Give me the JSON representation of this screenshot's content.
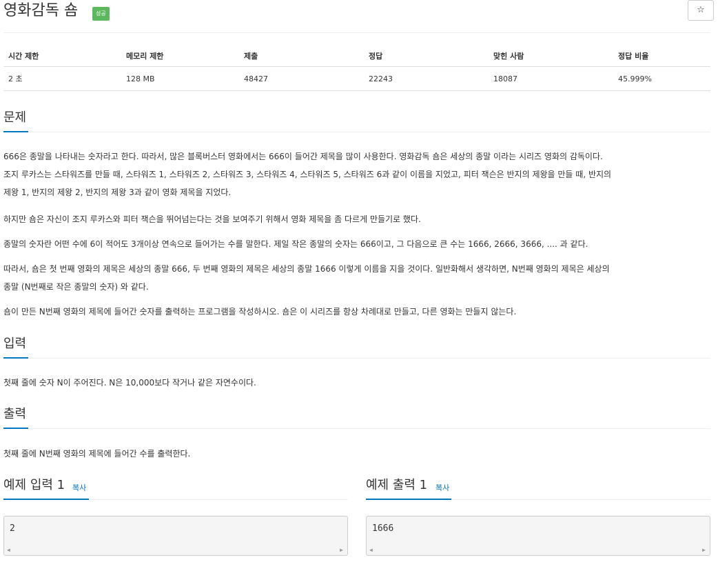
{
  "header": {
    "title": "영화감독 숌",
    "badge": "성공",
    "star": "☆"
  },
  "info_table": {
    "columns": [
      "시간 제한",
      "메모리 제한",
      "제출",
      "정답",
      "맞힌 사람",
      "정답 비율"
    ],
    "values": [
      "2 초",
      "128 MB",
      "48427",
      "22243",
      "18087",
      "45.999%"
    ]
  },
  "problem": {
    "heading": "문제",
    "p1_l1": "666은 종말을 나타내는 숫자라고 한다. 따라서, 많은 블록버스터 영화에서는 666이 들어간 제목을 많이 사용한다. 영화감독 숌은 세상의 종말 이라는 시리즈 영화의 감독이다.",
    "p1_l2": "조지 루카스는 스타워즈를 만들 때, 스타워즈 1, 스타워즈 2, 스타워즈 3, 스타워즈 4, 스타워즈 5, 스타워즈 6과 같이 이름을 지었고, 피터 잭슨은 반지의 제왕을 만들 때, 반지의",
    "p1_l3": "제왕 1, 반지의 제왕 2, 반지의 제왕 3과 같이 영화 제목을 지었다.",
    "p2": "하지만 숌은 자신이 조지 루카스와 피터 잭슨을 뛰어넘는다는 것을 보여주기 위해서 영화 제목을 좀 다르게 만들기로 했다.",
    "p3": "종말의 숫자란 어떤 수에 6이 적어도 3개이상 연속으로 들어가는 수를 말한다. 제일 작은 종말의 숫자는 666이고, 그 다음으로 큰 수는 1666, 2666, 3666, .... 과 같다.",
    "p4_l1": "따라서, 숌은 첫 번째 영화의 제목은 세상의 종말 666, 두 번째 영화의 제목은 세상의 종말 1666 이렇게 이름을 지을 것이다. 일반화해서 생각하면, N번째 영화의 제목은 세상의",
    "p4_l2": "종말 (N번째로 작은 종말의 숫자) 와 같다.",
    "p5": "숌이 만든 N번째 영화의 제목에 들어간 숫자를 출력하는 프로그램을 작성하시오. 숌은 이 시리즈를 항상 차례대로 만들고, 다른 영화는 만들지 않는다."
  },
  "input": {
    "heading": "입력",
    "text": "첫째 줄에 숫자 N이 주어진다. N은 10,000보다 작거나 같은 자연수이다."
  },
  "output": {
    "heading": "출력",
    "text": "첫째 줄에 N번째 영화의 제목에 들어간 수를 출력한다."
  },
  "sample_input": {
    "heading": "예제 입력 1",
    "copy": "복사",
    "value": "2"
  },
  "sample_output": {
    "heading": "예제 출력 1",
    "copy": "복사",
    "value": "1666"
  },
  "scroll": {
    "left": "◀",
    "right": "▶"
  }
}
